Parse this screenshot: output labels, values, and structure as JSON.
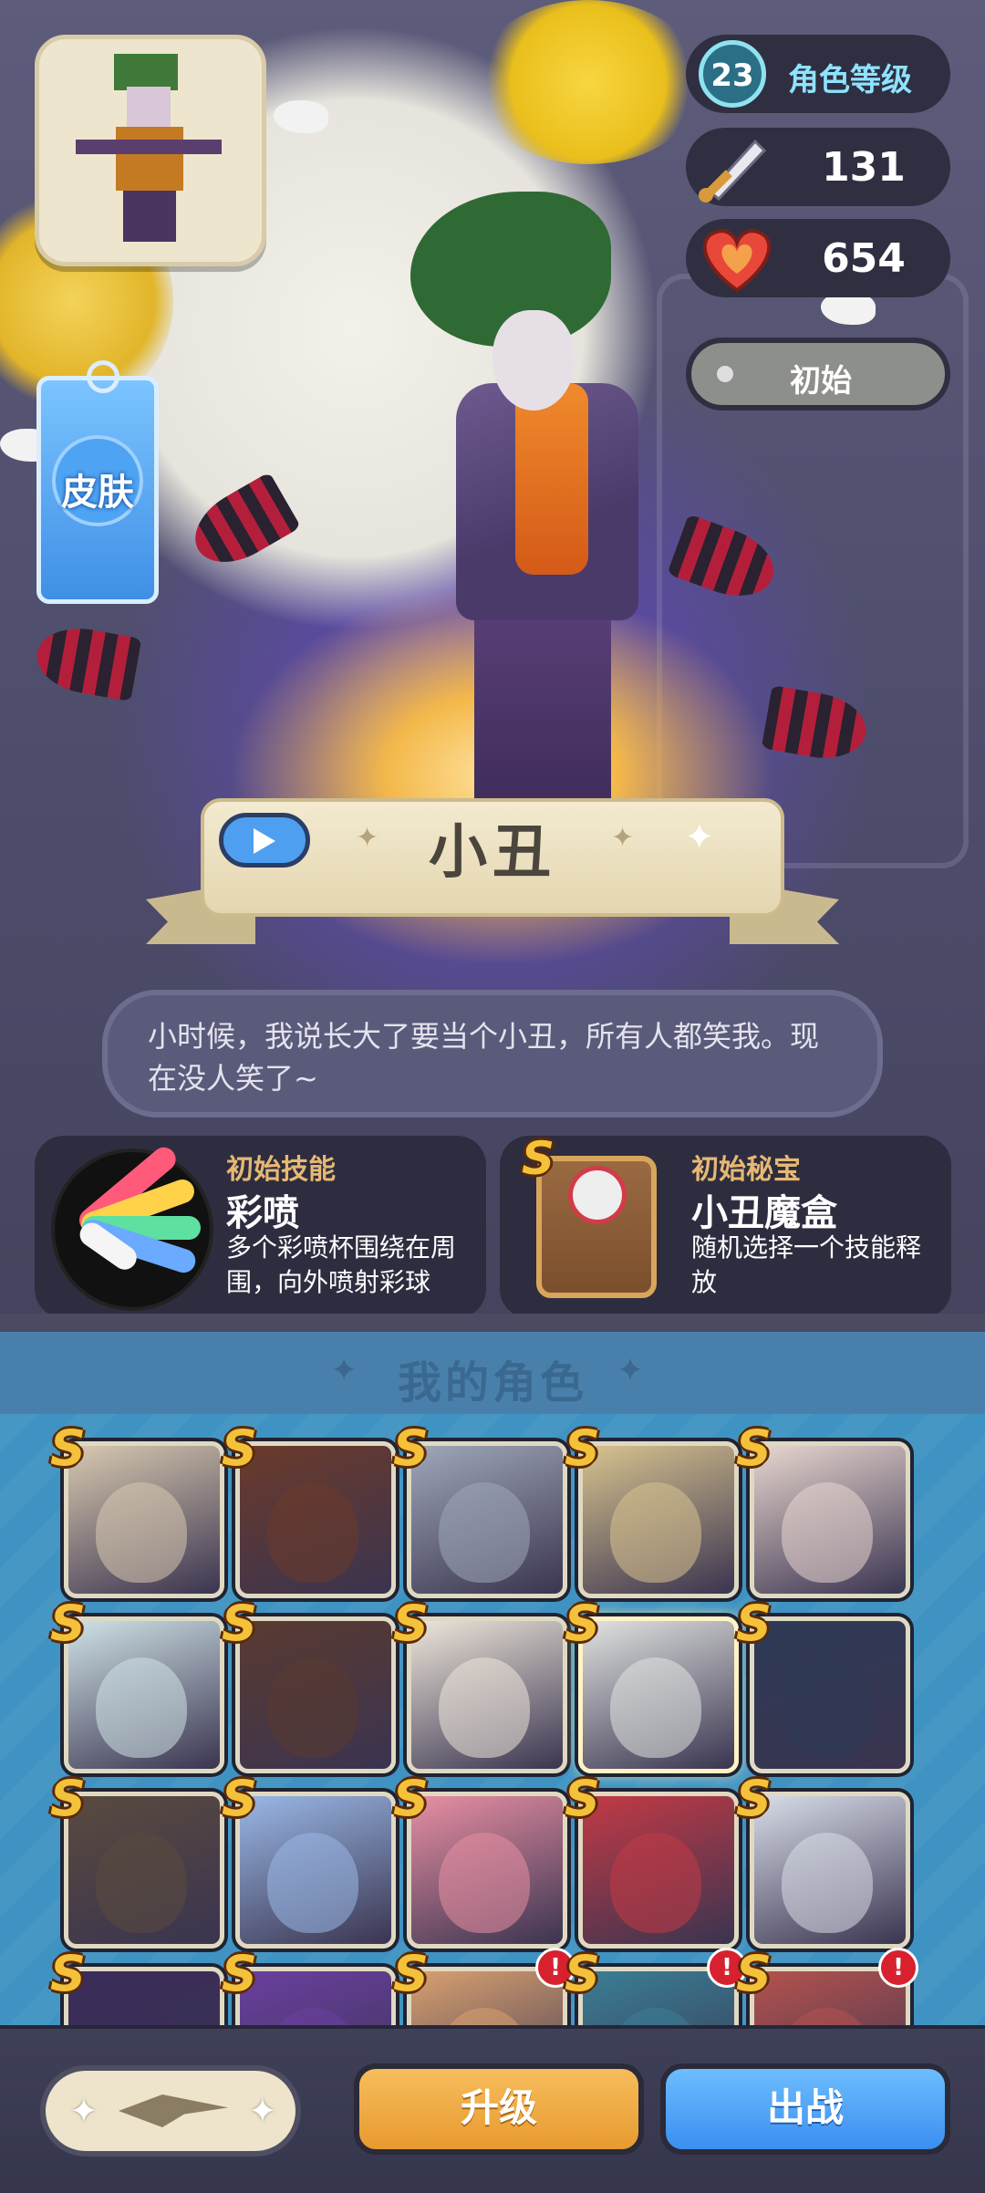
{
  "hero": {
    "name": "小丑",
    "quote": "小时候，我说长大了要当个小丑，所有人都笑我。现在没人笑了~",
    "skin_label": "皮肤",
    "level": {
      "value": "23",
      "label": "角色等级"
    },
    "attack": "131",
    "hp": "654",
    "state_label": "初始"
  },
  "skill": {
    "label": "初始技能",
    "name": "彩喷",
    "desc": "多个彩喷杯围绕在周围，向外喷射彩球"
  },
  "treasure": {
    "grade": "S",
    "label": "初始秘宝",
    "name": "小丑魔盒",
    "desc": "随机选择一个技能释放"
  },
  "roster": {
    "title": "我的角色",
    "cards": [
      {
        "grade": "S",
        "color": "#d8c9b0"
      },
      {
        "grade": "S",
        "color": "#6b3a2a"
      },
      {
        "grade": "S",
        "color": "#9fa7b8"
      },
      {
        "grade": "S",
        "color": "#d8c38f"
      },
      {
        "grade": "S",
        "color": "#e8d6cf"
      },
      {
        "grade": "S",
        "color": "#cfe2e6"
      },
      {
        "grade": "S",
        "color": "#5a3a30"
      },
      {
        "grade": "S",
        "color": "#ede6da"
      },
      {
        "grade": "S",
        "color": "#e0e3e0",
        "selected": true
      },
      {
        "grade": "S",
        "color": "#2d3a55"
      },
      {
        "grade": "S",
        "color": "#5a4a3e"
      },
      {
        "grade": "S",
        "color": "#9ab8e6"
      },
      {
        "grade": "S",
        "color": "#e88fa3"
      },
      {
        "grade": "S",
        "color": "#c23a45"
      },
      {
        "grade": "S",
        "color": "#d8dde8"
      },
      {
        "grade": "S",
        "color": "#3a2c5a"
      },
      {
        "grade": "S",
        "color": "#6a3fa0"
      },
      {
        "grade": "S",
        "color": "#d8a070",
        "alert": "!"
      },
      {
        "grade": "S",
        "color": "#3a7e95",
        "alert": "!"
      },
      {
        "grade": "S",
        "color": "#b3524e",
        "alert": "!"
      }
    ]
  },
  "actions": {
    "upgrade": "升级",
    "battle": "出战"
  },
  "icons": {
    "attack": "sword-icon",
    "hp": "heart-icon",
    "voice": "play-icon",
    "sparkle": "sparkle-icon"
  }
}
